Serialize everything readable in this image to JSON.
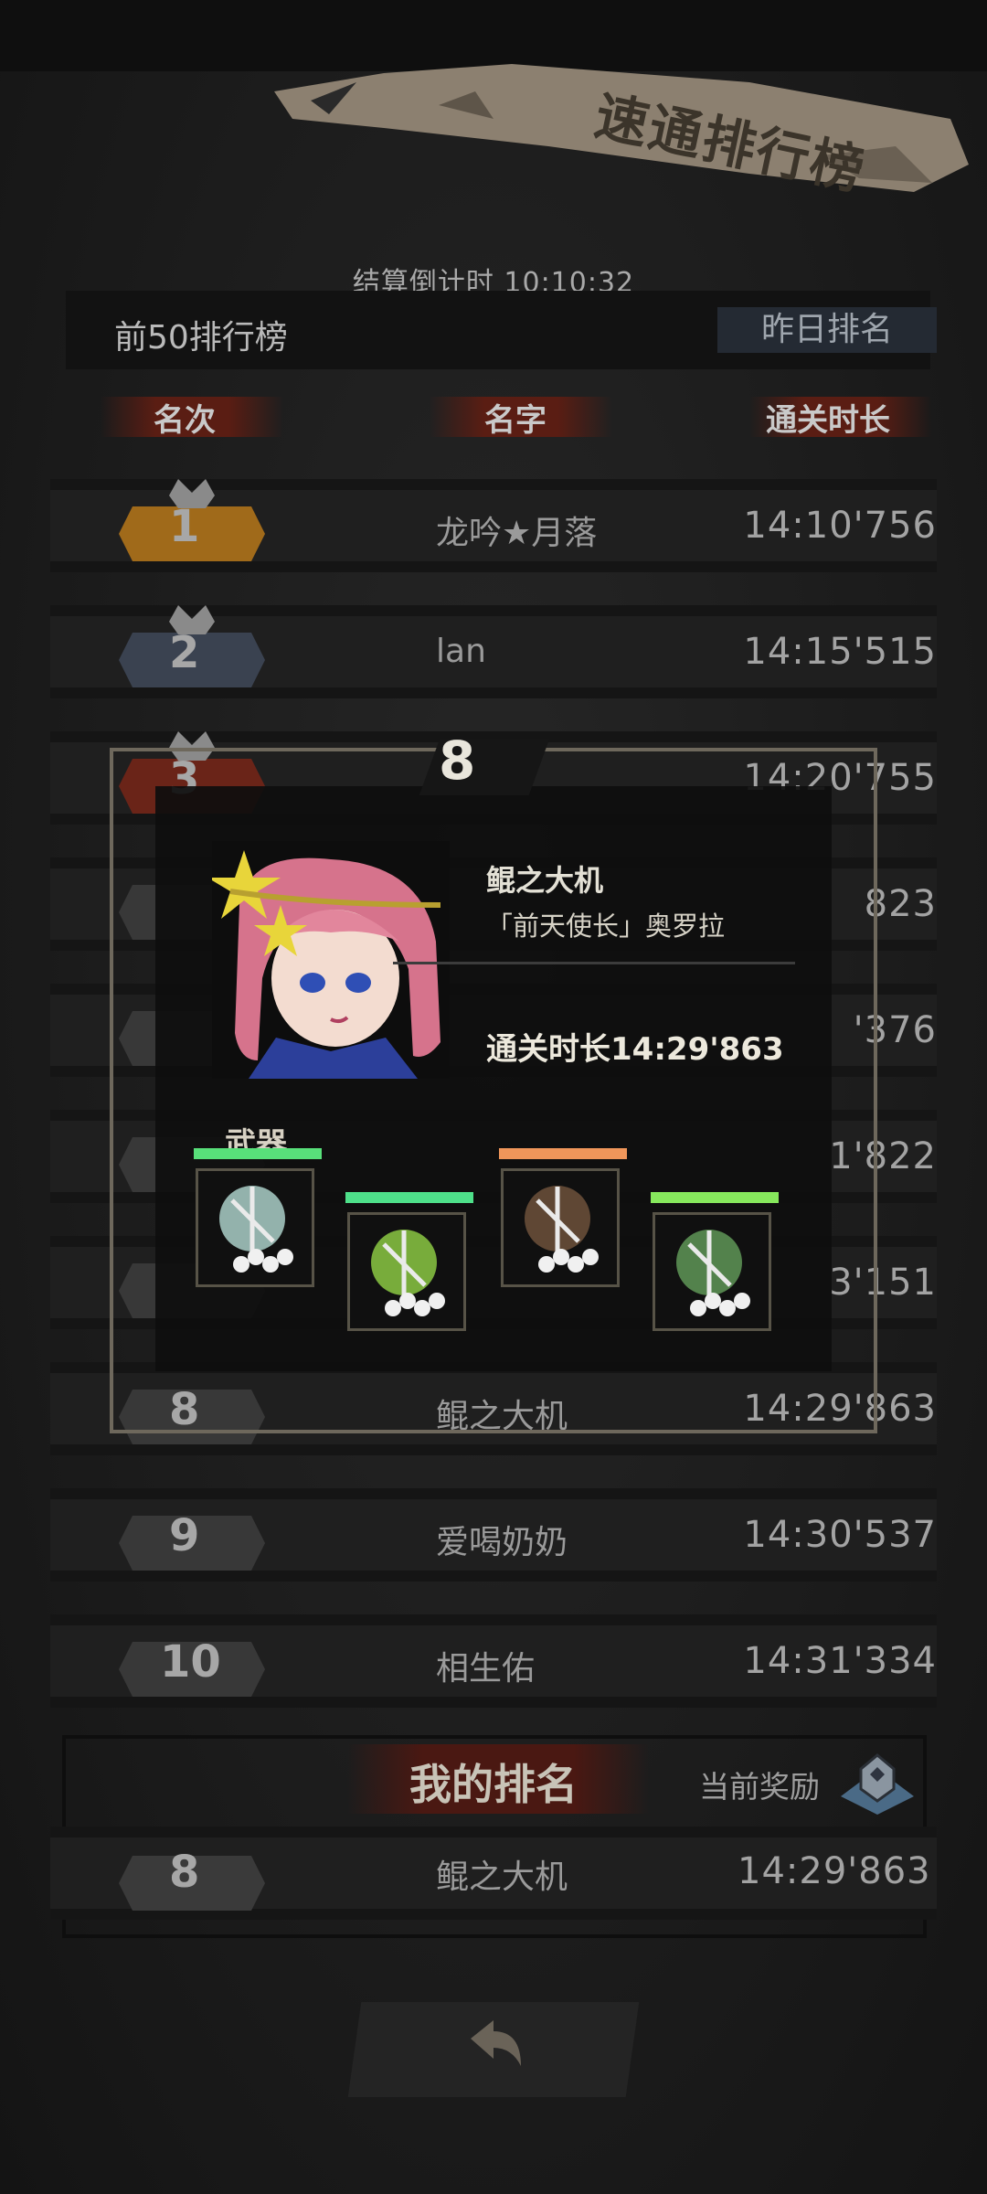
{
  "header": {
    "title": "速通排行榜",
    "countdown": "结算倒计时 10:10:32"
  },
  "tabs": {
    "top50": "前50排行榜",
    "yesterday": "昨日排名"
  },
  "columns": {
    "rank": "名次",
    "name": "名字",
    "time": "通关时长"
  },
  "rows": [
    {
      "rank": "1",
      "name": "龙吟★月落",
      "time": "14:10'756",
      "badge_color": "#a06a1a"
    },
    {
      "rank": "2",
      "name": "lan",
      "time": "14:15'515",
      "badge_color": "#3a4250"
    },
    {
      "rank": "3",
      "name": "",
      "time": "14:20'755",
      "badge_color": "#6a2418"
    },
    {
      "rank": "",
      "name": "",
      "time": "823"
    },
    {
      "rank": "",
      "name": "",
      "time": "'376"
    },
    {
      "rank": "",
      "name": "",
      "time": "1'822"
    },
    {
      "rank": "",
      "name": "",
      "time": "3'151"
    },
    {
      "rank": "8",
      "name": "鲲之大机",
      "time": "14:29'863"
    },
    {
      "rank": "9",
      "name": "爱喝奶奶",
      "time": "14:30'537"
    },
    {
      "rank": "10",
      "name": "相生佑",
      "time": "14:31'334"
    }
  ],
  "popup": {
    "rank": "8",
    "name": "鲲之大机",
    "title": "「前天使长」奥罗拉",
    "time": "通关时长14:29'863",
    "weapons_label": "武器",
    "weapons": [
      {
        "icon": "spear-weapon-icon",
        "bar_color": "#58e07a"
      },
      {
        "icon": "green-orb-weapon-icon",
        "bar_color": "#4ee08a"
      },
      {
        "icon": "horned-helm-weapon-icon",
        "bar_color": "#f0965a"
      },
      {
        "icon": "lantern-weapon-icon",
        "bar_color": "#86e85c"
      }
    ]
  },
  "my_rank": {
    "title": "我的排名",
    "reward_label": "当前奖励",
    "rank": "8",
    "name": "鲲之大机",
    "time": "14:29'863"
  },
  "colors": {
    "title_banner": "#8c8070",
    "accent_red": "#5a1d13"
  }
}
